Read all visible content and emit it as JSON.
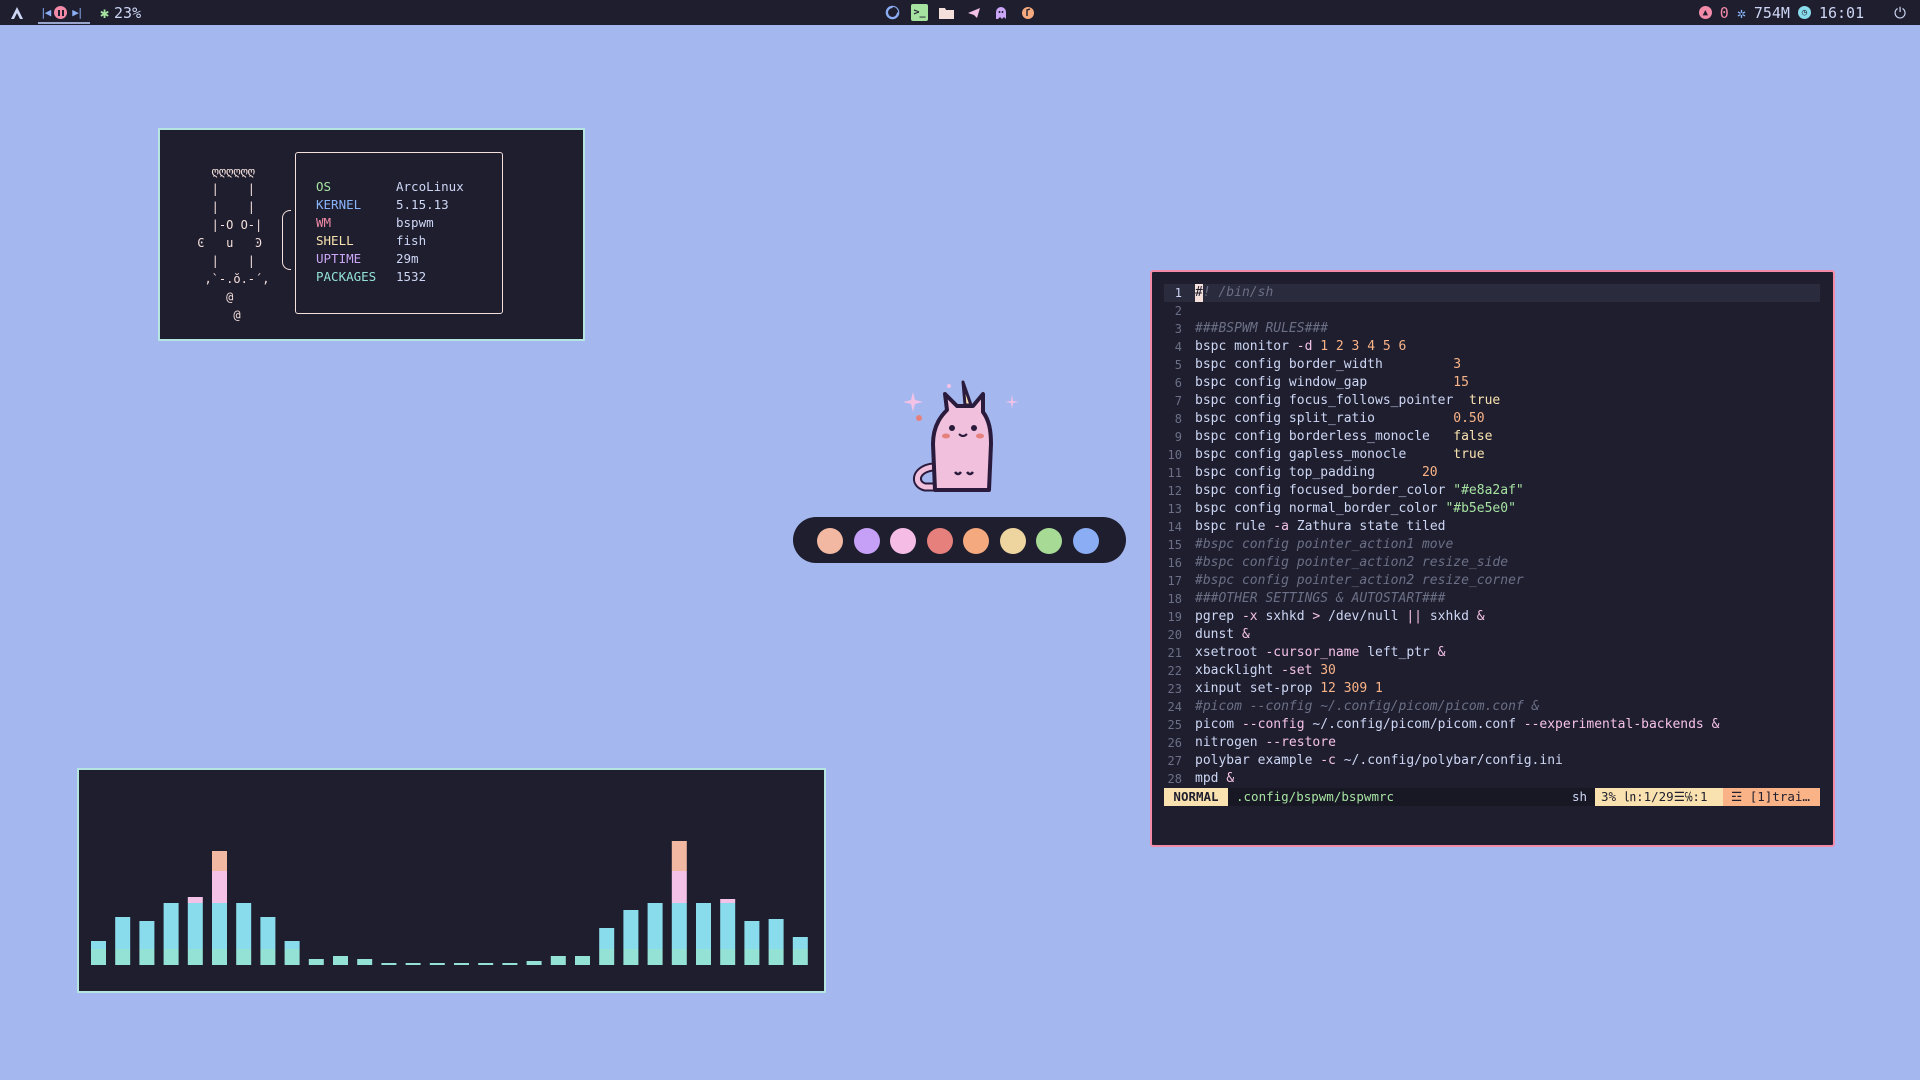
{
  "topbar": {
    "cpu_percent": "23%",
    "updates_count": "0",
    "memory": "754M",
    "time": "16:01",
    "icons": {
      "launcher": "arch-logo-icon",
      "media": [
        "previous-icon",
        "pause-icon",
        "next-icon"
      ],
      "cpu": "gear-icon",
      "apps": [
        "firefox-icon",
        "terminal-icon",
        "folder-icon",
        "telegram-icon",
        "ghost-icon",
        "music-icon"
      ],
      "updates": "arch-update-icon",
      "memory": "settings-icon",
      "clock": "clock-icon",
      "power": "power-icon"
    },
    "colors": {
      "bar": "#1e1e2e",
      "accent": "#a6e3a1",
      "alert": "#f38ba8"
    }
  },
  "fetch": {
    "rows": [
      {
        "key": "OS",
        "value": "ArcoLinux",
        "key_color": "#a6e3a1"
      },
      {
        "key": "KERNEL",
        "value": "5.15.13",
        "key_color": "#89b4fa"
      },
      {
        "key": "WM",
        "value": "bspwm",
        "key_color": "#f38ba8"
      },
      {
        "key": "SHELL",
        "value": "fish",
        "key_color": "#f9e2af"
      },
      {
        "key": "UPTIME",
        "value": "29m",
        "key_color": "#cba6f7"
      },
      {
        "key": "PACKAGES",
        "value": "1532",
        "key_color": "#94e2d5"
      }
    ],
    "ascii_art": [
      "   ღღღღღღ",
      "   |    |",
      "   |    |",
      "   |-O O-|",
      " Ͼ   u   Ͽ",
      "   |    |",
      "  ,`-.ŏ.-´,",
      "     @",
      "      @"
    ]
  },
  "palette": {
    "colors": [
      "#f2b8a2",
      "#c6a0f6",
      "#f5bde6",
      "#e6807c",
      "#f5a97f",
      "#eed49f",
      "#a6da95",
      "#8aadf4"
    ]
  },
  "visualizer": {
    "bars": [
      [
        24,
        0,
        0
      ],
      [
        48,
        0,
        0
      ],
      [
        44,
        0,
        0
      ],
      [
        62,
        0,
        0
      ],
      [
        62,
        6,
        0
      ],
      [
        62,
        32,
        20
      ],
      [
        62,
        0,
        0
      ],
      [
        48,
        0,
        0
      ],
      [
        24,
        0,
        0
      ],
      [
        6,
        0,
        0
      ],
      [
        9,
        0,
        0
      ],
      [
        6,
        0,
        0
      ],
      [
        2,
        0,
        0
      ],
      [
        2,
        0,
        0
      ],
      [
        2,
        0,
        0
      ],
      [
        2,
        0,
        0
      ],
      [
        2,
        0,
        0
      ],
      [
        2,
        0,
        0
      ],
      [
        4,
        0,
        0
      ],
      [
        9,
        0,
        0
      ],
      [
        9,
        0,
        0
      ],
      [
        37,
        0,
        0
      ],
      [
        55,
        0,
        0
      ],
      [
        62,
        0,
        0
      ],
      [
        62,
        32,
        30
      ],
      [
        62,
        0,
        0
      ],
      [
        62,
        4,
        0
      ],
      [
        44,
        0,
        0
      ],
      [
        46,
        0,
        0
      ],
      [
        28,
        0,
        0
      ]
    ],
    "colors": {
      "base": "#94e2d5",
      "mid": "#89dceb",
      "high": "#f5c2e7",
      "peak": "#f2b8a2"
    }
  },
  "editor": {
    "lines": [
      {
        "n": "1",
        "text": "#! /bin/sh",
        "cls": "comment"
      },
      {
        "n": "2",
        "text": "",
        "cls": ""
      },
      {
        "n": "3",
        "text": "###BSPWM RULES###",
        "cls": "comment"
      },
      {
        "n": "4",
        "text": "bspc monitor -d 1 2 3 4 5 6",
        "cls": ""
      },
      {
        "n": "5",
        "text": "bspc config border_width         3",
        "cls": ""
      },
      {
        "n": "6",
        "text": "bspc config window_gap           15",
        "cls": ""
      },
      {
        "n": "7",
        "text": "bspc config focus_follows_pointer  true",
        "cls": ""
      },
      {
        "n": "8",
        "text": "bspc config split_ratio          0.50",
        "cls": ""
      },
      {
        "n": "9",
        "text": "bspc config borderless_monocle   false",
        "cls": ""
      },
      {
        "n": "10",
        "text": "bspc config gapless_monocle      true",
        "cls": ""
      },
      {
        "n": "11",
        "text": "bspc config top_padding      20",
        "cls": ""
      },
      {
        "n": "12",
        "text": "bspc config focused_border_color \"#e8a2af\"",
        "cls": ""
      },
      {
        "n": "13",
        "text": "bspc config normal_border_color \"#b5e5e0\"",
        "cls": ""
      },
      {
        "n": "14",
        "text": "bspc rule -a Zathura state tiled",
        "cls": ""
      },
      {
        "n": "15",
        "text": "#bspc config pointer_action1 move",
        "cls": "comment"
      },
      {
        "n": "16",
        "text": "#bspc config pointer_action2 resize_side",
        "cls": "comment"
      },
      {
        "n": "17",
        "text": "#bspc config pointer_action2 resize_corner",
        "cls": "comment"
      },
      {
        "n": "18",
        "text": "###OTHER SETTINGS & AUTOSTART###",
        "cls": "comment"
      },
      {
        "n": "19",
        "text": "pgrep -x sxhkd > /dev/null || sxhkd &",
        "cls": ""
      },
      {
        "n": "20",
        "text": "dunst &",
        "cls": ""
      },
      {
        "n": "21",
        "text": "xsetroot -cursor_name left_ptr &",
        "cls": ""
      },
      {
        "n": "22",
        "text": "xbacklight -set 30",
        "cls": ""
      },
      {
        "n": "23",
        "text": "xinput set-prop 12 309 1",
        "cls": ""
      },
      {
        "n": "24",
        "text": "#picom --config ~/.config/picom/picom.conf &",
        "cls": "comment"
      },
      {
        "n": "25",
        "text": "picom --config ~/.config/picom/picom.conf --experimental-backends &",
        "cls": ""
      },
      {
        "n": "26",
        "text": "nitrogen --restore",
        "cls": ""
      },
      {
        "n": "27",
        "text": "polybar example -c ~/.config/polybar/config.ini",
        "cls": ""
      },
      {
        "n": "28",
        "text": "mpd &",
        "cls": ""
      }
    ],
    "statusline": {
      "mode": "NORMAL",
      "file": ".config/bspwm/bspwmrc",
      "filetype": "sh",
      "position": "3% ㏑:1/29☰℅:1",
      "trailing": "☲ [1]trai…"
    }
  }
}
